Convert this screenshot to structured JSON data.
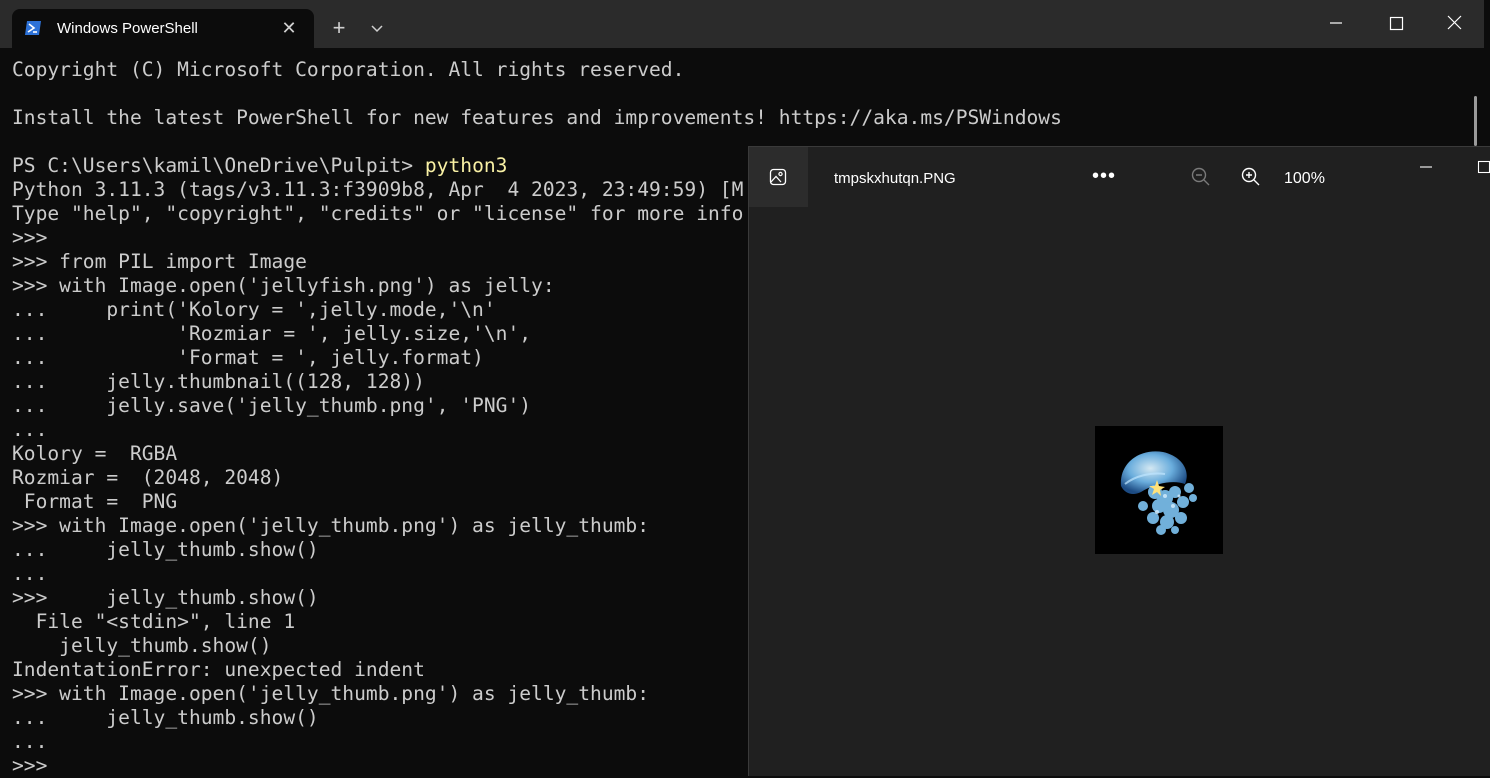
{
  "terminal": {
    "tab_title": "Windows PowerShell",
    "tab_icon": "powershell-icon",
    "lines": [
      "Copyright (C) Microsoft Corporation. All rights reserved.",
      "",
      "Install the latest PowerShell for new features and improvements! https://aka.ms/PSWindows",
      "",
      "PS C:\\Users\\kamil\\OneDrive\\Pulpit> ",
      "Python 3.11.3 (tags/v3.11.3:f3909b8, Apr  4 2023, 23:49:59) [M",
      "Type \"help\", \"copyright\", \"credits\" or \"license\" for more info",
      ">>>",
      ">>> from PIL import Image",
      ">>> with Image.open('jellyfish.png') as jelly:",
      "...     print('Kolory = ',jelly.mode,'\\n'",
      "...           'Rozmiar = ', jelly.size,'\\n',",
      "...           'Format = ', jelly.format)",
      "...     jelly.thumbnail((128, 128))",
      "...     jelly.save('jelly_thumb.png', 'PNG')",
      "...",
      "Kolory =  RGBA",
      "Rozmiar =  (2048, 2048)",
      " Format =  PNG",
      ">>> with Image.open('jelly_thumb.png') as jelly_thumb:",
      "...     jelly_thumb.show()",
      "...",
      ">>>     jelly_thumb.show()",
      "  File \"<stdin>\", line 1",
      "    jelly_thumb.show()",
      "IndentationError: unexpected indent",
      ">>> with Image.open('jelly_thumb.png') as jelly_thumb:",
      "...     jelly_thumb.show()",
      "...",
      ">>>"
    ],
    "prompt_command": "python3",
    "colors": {
      "background": "#0c0c0c",
      "text": "#cccccc",
      "command": "#f9f1a5"
    }
  },
  "viewer": {
    "filename": "tmpskxhutqn.PNG",
    "more_label": "•••",
    "zoom_level": "100%",
    "app_icon": "photo-icon"
  }
}
